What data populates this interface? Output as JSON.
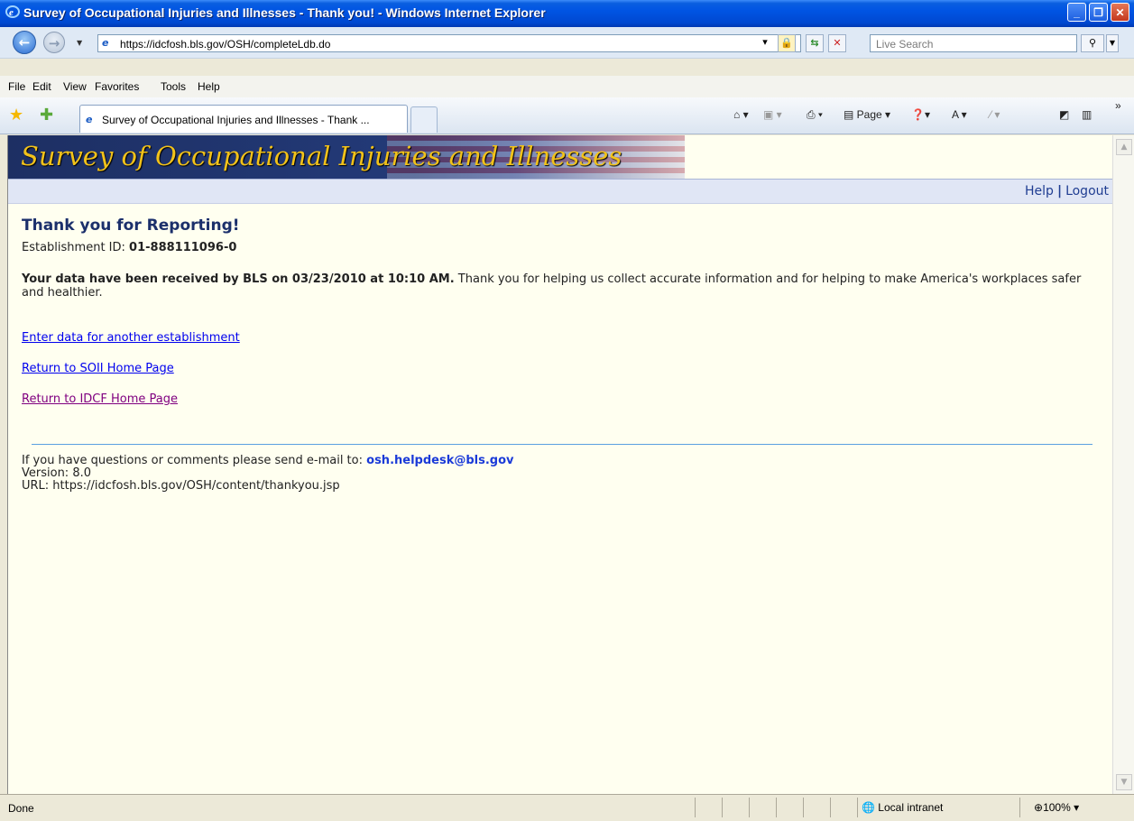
{
  "window": {
    "title": "Survey of Occupational Injuries and Illnesses - Thank you! - Windows Internet Explorer"
  },
  "address_bar": {
    "url": "https://idcfosh.bls.gov/OSH/completeLdb.do",
    "search_placeholder": "Live Search"
  },
  "menu": {
    "items": [
      "File",
      "Edit",
      "View",
      "Favorites",
      "Tools",
      "Help"
    ]
  },
  "tabs": [
    {
      "label": "Survey of Occupational Injuries and Illnesses - Thank ..."
    }
  ],
  "command_bar": {
    "page_label": "Page"
  },
  "page": {
    "banner_title": "Survey of Occupational Injuries and Illnesses",
    "help_label": "Help",
    "logout_label": "Logout",
    "heading": "Thank you for Reporting!",
    "establishment_label": "Establishment ID:",
    "establishment_id": "01-888111096-0",
    "received_bold": "Your data have been received by BLS on 03/23/2010 at 10:10 AM.",
    "received_rest": " Thank you for helping us collect accurate information and for helping to make America's workplaces safer and healthier.",
    "links": {
      "another": "Enter data for another establishment",
      "soii_home": "Return to SOII Home Page",
      "idcf_home": "Return to IDCF Home Page"
    },
    "footer": {
      "questions": "If you have questions or comments please send e-mail to:",
      "email": "osh.helpdesk@bls.gov",
      "version": "Version: 8.0",
      "url": "URL: https://idcfosh.bls.gov/OSH/content/thankyou.jsp"
    }
  },
  "status_bar": {
    "status": "Done",
    "zone": "Local intranet",
    "zoom": "100%"
  }
}
